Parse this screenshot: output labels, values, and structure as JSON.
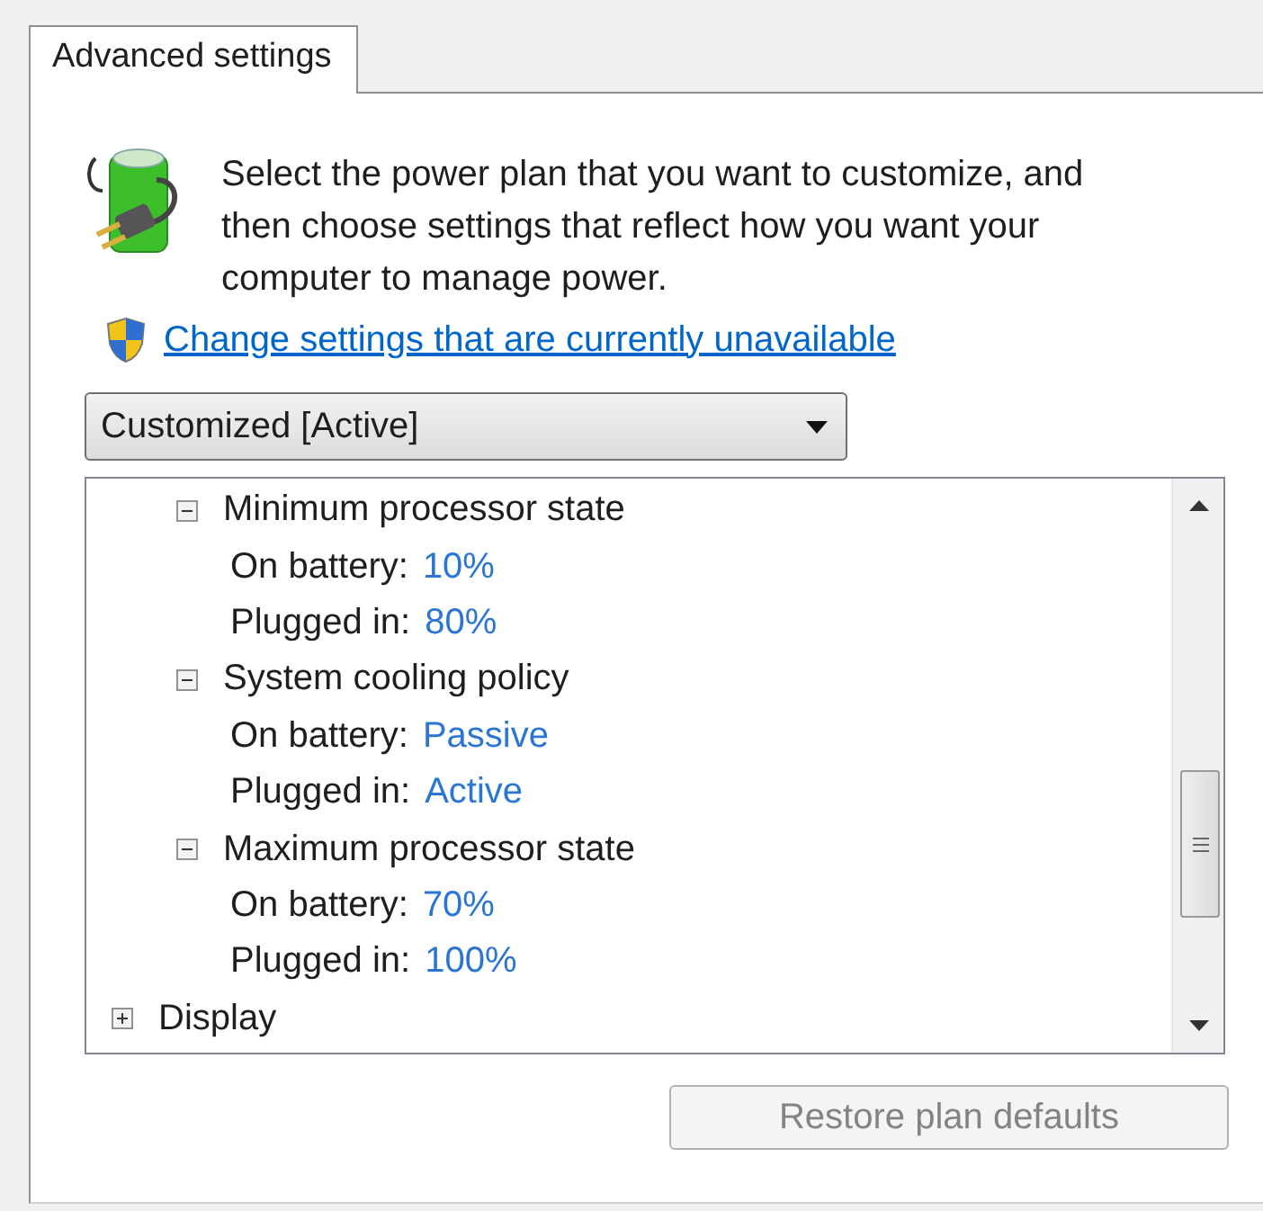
{
  "tabs": [
    {
      "label": "Advanced settings",
      "selected": true
    }
  ],
  "intro": "Select the power plan that you want to customize, and then choose settings that reflect how you want your computer to manage power.",
  "link": "Change settings that are currently unavailable",
  "plan_dropdown": {
    "value": "Customized [Active]"
  },
  "tree": [
    {
      "children": [
        {
          "label": "Minimum processor state",
          "expanded": true,
          "children": [
            {
              "label": "On battery:",
              "value": "10%"
            },
            {
              "label": "Plugged in:",
              "value": "80%"
            }
          ]
        },
        {
          "label": "System cooling policy",
          "expanded": true,
          "children": [
            {
              "label": "On battery:",
              "value": "Passive"
            },
            {
              "label": "Plugged in:",
              "value": "Active"
            }
          ]
        },
        {
          "label": "Maximum processor state",
          "expanded": true,
          "children": [
            {
              "label": "On battery:",
              "value": "70%"
            },
            {
              "label": "Plugged in:",
              "value": "100%"
            }
          ]
        }
      ]
    },
    {
      "label": "Display",
      "expanded": false
    }
  ],
  "restore_button": {
    "label": "Restore plan defaults",
    "disabled": true
  }
}
